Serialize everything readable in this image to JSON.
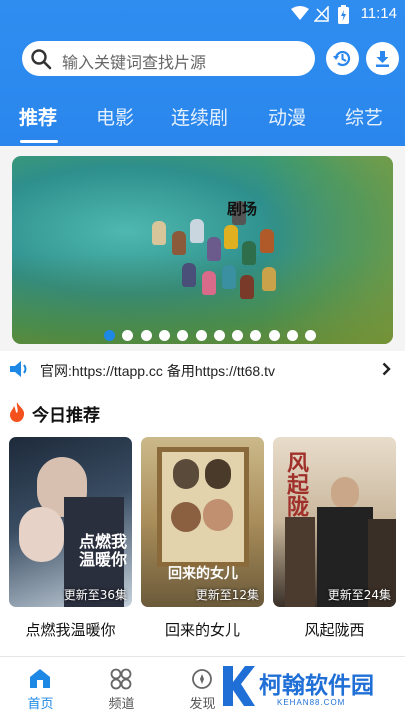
{
  "status_bar": {
    "time": "11:14"
  },
  "search": {
    "placeholder": "输入关键词查找片源"
  },
  "tabs": [
    {
      "label": "推荐",
      "active": true
    },
    {
      "label": "电影",
      "active": false
    },
    {
      "label": "连续剧",
      "active": false
    },
    {
      "label": "动漫",
      "active": false
    },
    {
      "label": "综艺",
      "active": false
    }
  ],
  "banner": {
    "logo_text": "剧场",
    "slide_count": 12,
    "active_slide": 0
  },
  "notice": {
    "text": "官网:https://ttapp.cc 备用https://tt68.tv"
  },
  "section": {
    "title": "今日推荐",
    "items": [
      {
        "title": "点燃我温暖你",
        "episodes": "更新至36集",
        "poster_text": "点燃我温暖你"
      },
      {
        "title": "回来的女儿",
        "episodes": "更新至12集",
        "poster_text": "回来的女儿"
      },
      {
        "title": "风起陇西",
        "episodes": "更新至24集",
        "poster_text": "风起陇西"
      }
    ]
  },
  "bottom_nav": [
    {
      "label": "首页",
      "icon": "home-icon",
      "active": true
    },
    {
      "label": "频道",
      "icon": "channels-icon",
      "active": false
    },
    {
      "label": "发现",
      "icon": "discover-icon",
      "active": false
    }
  ],
  "watermark": {
    "name": "柯翰软件园",
    "url": "KEHAN88.COM"
  },
  "colors": {
    "primary": "#2a86ec",
    "accent": "#1e88e5",
    "hot": "#f4511e"
  }
}
